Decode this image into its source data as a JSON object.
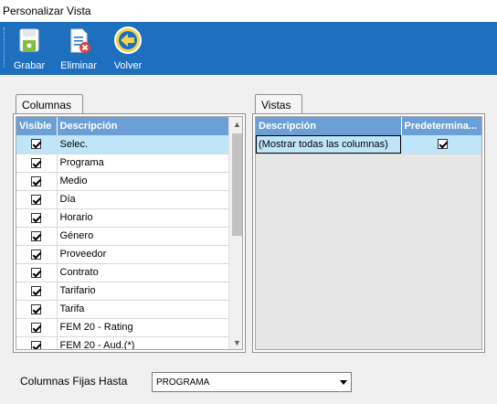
{
  "window": {
    "title": "Personalizar Vista"
  },
  "toolbar": {
    "buttons": [
      {
        "label": "Grabar",
        "icon": "save-disk-icon"
      },
      {
        "label": "Eliminar",
        "icon": "delete-document-icon"
      },
      {
        "label": "Volver",
        "icon": "back-arrow-icon"
      }
    ]
  },
  "columnas": {
    "tab_label": "Columnas",
    "headers": [
      "Visible",
      "Descripción"
    ],
    "rows": [
      {
        "visible": true,
        "descripcion": "Selec.",
        "selected": true
      },
      {
        "visible": true,
        "descripcion": "Programa"
      },
      {
        "visible": true,
        "descripcion": "Medio"
      },
      {
        "visible": true,
        "descripcion": "Día"
      },
      {
        "visible": true,
        "descripcion": "Horario"
      },
      {
        "visible": true,
        "descripcion": "Género"
      },
      {
        "visible": true,
        "descripcion": "Proveedor"
      },
      {
        "visible": true,
        "descripcion": "Contrato"
      },
      {
        "visible": true,
        "descripcion": "Tarifario"
      },
      {
        "visible": true,
        "descripcion": "Tarifa"
      },
      {
        "visible": true,
        "descripcion": "FEM 20 - Rating"
      },
      {
        "visible": true,
        "descripcion": "FEM 20 - Aud.(*)"
      }
    ]
  },
  "vistas": {
    "tab_label": "Vistas",
    "headers": [
      "Descripción",
      "Predetermina..."
    ],
    "rows": [
      {
        "descripcion": "(Mostrar todas las columnas)",
        "predeterminada": true,
        "selected": true
      }
    ]
  },
  "fixed_columns": {
    "label": "Columnas Fijas Hasta",
    "value": "PROGRAMA"
  },
  "colors": {
    "toolbar_bg": "#1f6fbf",
    "grid_header_bg": "#6c9fd6",
    "selected_row_bg": "#bfe6f8"
  }
}
